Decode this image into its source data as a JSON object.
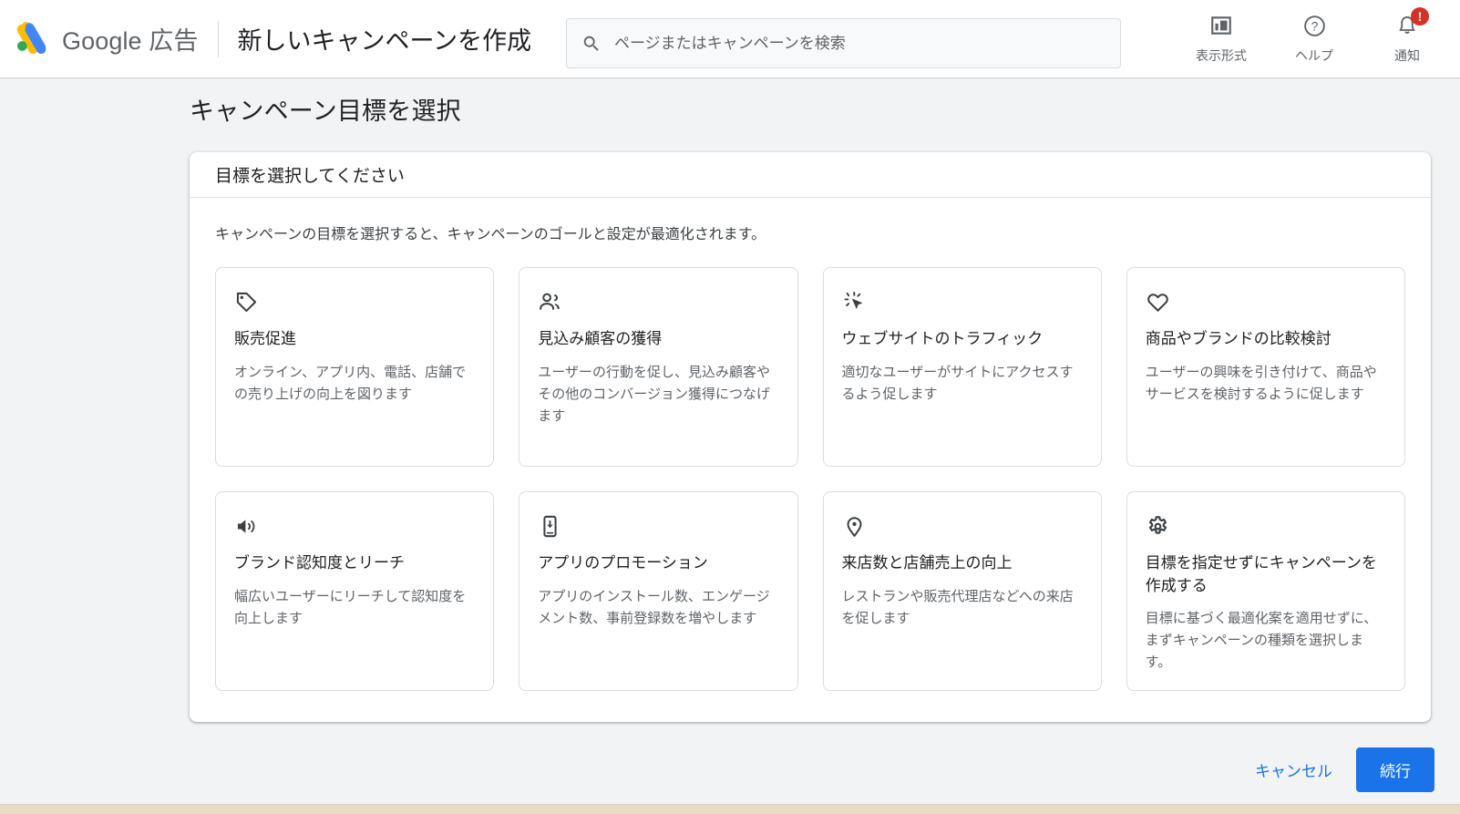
{
  "header": {
    "brand_google": "Google",
    "brand_ads": "広告",
    "page_context": "新しいキャンペーンを作成",
    "search": {
      "placeholder": "ページまたはキャンペーンを検索",
      "value": "",
      "icon": "search-icon"
    },
    "actions": [
      {
        "label": "表示形式",
        "icon": "display-format-icon",
        "badge": ""
      },
      {
        "label": "ヘルプ",
        "icon": "help-icon",
        "badge": ""
      },
      {
        "label": "通知",
        "icon": "notifications-bell-icon",
        "badge": "!"
      }
    ]
  },
  "page": {
    "title": "キャンペーン目標を選択"
  },
  "panel": {
    "header": "目標を選択してください",
    "description": "キャンペーンの目標を選択すると、キャンペーンのゴールと設定が最適化されます。"
  },
  "goals": [
    {
      "id": "sales",
      "icon": "price-tag-icon",
      "title": "販売促進",
      "description": "オンライン、アプリ内、電話、店舗での売り上げの向上を図ります"
    },
    {
      "id": "leads",
      "icon": "people-group-icon",
      "title": "見込み顧客の獲得",
      "description": "ユーザーの行動を促し、見込み顧客やその他のコンバージョン獲得につなげます"
    },
    {
      "id": "website-traffic",
      "icon": "ad-click-cursor-icon",
      "title": "ウェブサイトのトラフィック",
      "description": "適切なユーザーがサイトにアクセスするよう促します"
    },
    {
      "id": "product-brand-consideration",
      "icon": "heart-icon",
      "title": "商品やブランドの比較検討",
      "description": "ユーザーの興味を引き付けて、商品やサービスを検討するように促します"
    },
    {
      "id": "brand-awareness-reach",
      "icon": "speaker-volume-icon",
      "title": "ブランド認知度とリーチ",
      "description": "幅広いユーザーにリーチして認知度を向上します"
    },
    {
      "id": "app-promotion",
      "icon": "mobile-download-icon",
      "title": "アプリのプロモーション",
      "description": "アプリのインストール数、エンゲージメント数、事前登録数を増やします"
    },
    {
      "id": "local-store-visits",
      "icon": "location-pin-icon",
      "title": "来店数と店舗売上の向上",
      "description": "レストランや販売代理店などへの来店を促します"
    },
    {
      "id": "no-goal",
      "icon": "gear-settings-icon",
      "title": "目標を指定せずにキャンペーンを作成する",
      "description": "目標に基づく最適化案を適用せずに、まずキャンペーンの種類を選択します。"
    }
  ],
  "footer": {
    "cancel_label": "キャンセル",
    "continue_label": "続行"
  },
  "colors": {
    "accent_blue": "#1a73e8",
    "badge_red": "#d93025",
    "page_bg": "#f1f3f4",
    "panel_bg": "#ffffff",
    "card_border": "#dadce0",
    "text_primary": "#202124",
    "text_secondary": "#5f6368",
    "bottom_strip": "#e6dcc8"
  }
}
